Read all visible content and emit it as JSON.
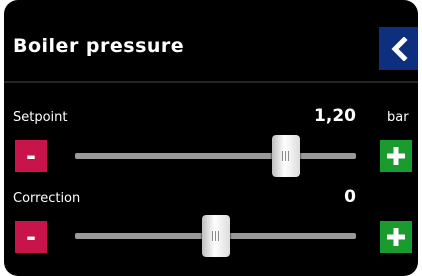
{
  "screen": {
    "title": "Boiler pressure",
    "back_icon": "chevron-left-icon"
  },
  "setpoint": {
    "label": "Setpoint",
    "value": "1,20",
    "unit": "bar",
    "minus_label": "-",
    "slider_level": 0.75
  },
  "correction": {
    "label": "Correction",
    "value": "0",
    "minus_label": "-",
    "slider_level": 0.5
  },
  "colors": {
    "back_button": "#0d2f7e",
    "minus_button": "#c8134b",
    "plus_button": "#1a9b2e",
    "background": "#000000"
  }
}
